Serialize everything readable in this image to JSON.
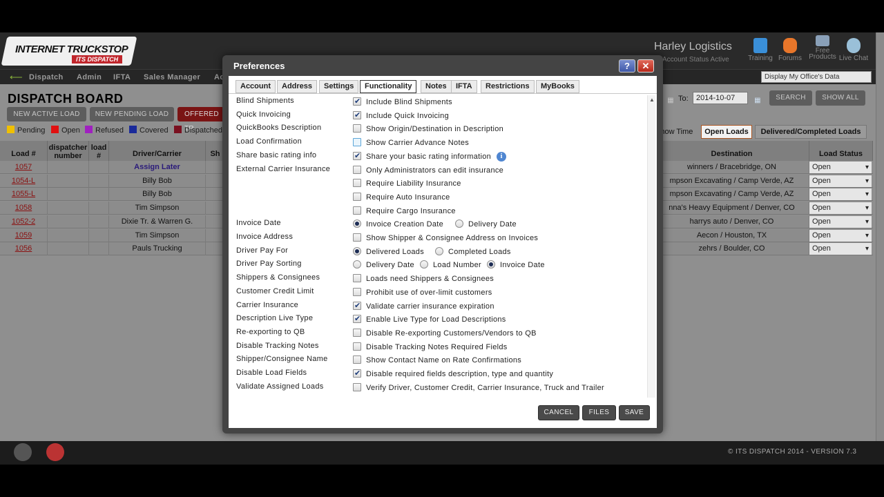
{
  "header": {
    "logo_line1": "INTERNET TRUCKSTOP",
    "logo_line2": "ITS DISPATCH",
    "company": "Harley Logistics",
    "account_status": "Account Status Active",
    "icons": [
      {
        "label": "Training",
        "icon": "book-icon"
      },
      {
        "label": "Forums",
        "icon": "speech-bubbles-icon"
      },
      {
        "label": "Free Products",
        "icon": "handshake-icon"
      },
      {
        "label": "Live Chat",
        "icon": "people-icon"
      }
    ]
  },
  "nav": {
    "items": [
      "Dispatch",
      "Admin",
      "IFTA",
      "Sales Manager",
      "Ac"
    ],
    "office_select": "Display My Office's Data"
  },
  "board": {
    "title": "DISPATCH BOARD",
    "buttons": [
      "NEW ACTIVE LOAD",
      "NEW PENDING LOAD",
      "OFFERED TR"
    ],
    "legend": [
      {
        "label": "Pending",
        "color": "#f0c000"
      },
      {
        "label": "Open",
        "color": "#e01010"
      },
      {
        "label": "Refused",
        "color": "#a020c0"
      },
      {
        "label": "Covered",
        "color": "#1a2a9a"
      },
      {
        "label": "Dispatched",
        "color": "#7a1020"
      }
    ],
    "date_to_label": "To:",
    "date_to_value": "2014-10-07",
    "search_label": "SEARCH",
    "show_all_label": "SHOW ALL",
    "tabs_right": [
      "Show Time",
      "Open Loads",
      "Delivered/Completed Loads"
    ],
    "columns_left": [
      "Load #",
      "dispatcher number",
      "load #",
      "Driver/Carrier",
      "Sh"
    ],
    "columns_right": [
      "Destination",
      "Load Status"
    ],
    "rows": [
      {
        "load": "1057",
        "driver": "Assign Later",
        "destination": "winners / Bracebridge, ON",
        "status": "Open"
      },
      {
        "load": "1054-L",
        "driver": "Billy Bob",
        "destination": "mpson Excavating / Camp Verde, AZ",
        "status": "Open"
      },
      {
        "load": "1055-L",
        "driver": "Billy Bob",
        "destination": "mpson Excavating / Camp Verde, AZ",
        "status": "Open"
      },
      {
        "load": "1058",
        "driver": "Tim Simpson",
        "destination": "nna's Heavy Equipment / Denver, CO",
        "status": "Open"
      },
      {
        "load": "1052-2",
        "driver": "Dixie Tr. & Warren G.",
        "destination": "harrys auto / Denver, CO",
        "status": "Open"
      },
      {
        "load": "1059",
        "driver": "Tim Simpson",
        "destination": "Aecon / Houston, TX",
        "status": "Open"
      },
      {
        "load": "1056",
        "driver": "Pauls Trucking",
        "destination": "zehrs / Boulder, CO",
        "status": "Open"
      }
    ]
  },
  "footer": {
    "text": "© ITS DISPATCH 2014  -  VERSION 7.3"
  },
  "modal": {
    "title": "Preferences",
    "tabs": [
      "Account",
      "Address",
      "Settings",
      "Functionality",
      "Notes",
      "IFTA",
      "Restrictions",
      "MyBooks"
    ],
    "active_tab": "Functionality",
    "prefs": [
      {
        "label": "Blind Shipments",
        "options": [
          {
            "type": "checkbox",
            "text": "Include Blind Shipments",
            "checked": true
          }
        ]
      },
      {
        "label": "Quick Invoicing",
        "options": [
          {
            "type": "checkbox",
            "text": "Include Quick Invoicing",
            "checked": true
          }
        ]
      },
      {
        "label": "QuickBooks Description",
        "options": [
          {
            "type": "checkbox",
            "text": "Show Origin/Destination in Description",
            "checked": false
          }
        ]
      },
      {
        "label": "Load Confirmation",
        "options": [
          {
            "type": "checkbox",
            "text": "Show Carrier Advance Notes",
            "checked": false
          }
        ]
      },
      {
        "label": "Share basic rating info",
        "options": [
          {
            "type": "checkbox",
            "text": "Share your basic rating information",
            "checked": true
          }
        ]
      },
      {
        "label": "External Carrier Insurance",
        "options": [
          {
            "type": "checkbox",
            "text": "Only Administrators can edit insurance",
            "checked": false
          }
        ]
      },
      {
        "label": "",
        "options": [
          {
            "type": "checkbox",
            "text": "Require Liability Insurance",
            "checked": false
          }
        ]
      },
      {
        "label": "",
        "options": [
          {
            "type": "checkbox",
            "text": "Require Auto Insurance",
            "checked": false
          }
        ]
      },
      {
        "label": "",
        "options": [
          {
            "type": "checkbox",
            "text": "Require Cargo Insurance",
            "checked": false
          }
        ]
      },
      {
        "label": "Invoice Date",
        "options": [
          {
            "type": "radio",
            "text": "Invoice Creation Date",
            "checked": true
          },
          {
            "type": "radio",
            "text": "Delivery Date",
            "checked": false
          }
        ]
      },
      {
        "label": "Invoice Address",
        "options": [
          {
            "type": "checkbox",
            "text": "Show Shipper & Consignee Address on Invoices",
            "checked": false
          }
        ]
      },
      {
        "label": "Driver Pay For",
        "options": [
          {
            "type": "radio",
            "text": "Delivered Loads",
            "checked": true
          },
          {
            "type": "radio",
            "text": "Completed Loads",
            "checked": false
          }
        ]
      },
      {
        "label": "Driver Pay Sorting",
        "options": [
          {
            "type": "radio",
            "text": "Delivery Date",
            "checked": false
          },
          {
            "type": "radio",
            "text": "Load Number",
            "checked": false
          },
          {
            "type": "radio",
            "text": "Invoice Date",
            "checked": true
          }
        ]
      },
      {
        "label": "Shippers & Consignees",
        "options": [
          {
            "type": "checkbox",
            "text": "Loads need Shippers & Consignees",
            "checked": false
          }
        ]
      },
      {
        "label": "Customer Credit Limit",
        "options": [
          {
            "type": "checkbox",
            "text": "Prohibit use of over-limit customers",
            "checked": false
          }
        ]
      },
      {
        "label": "Carrier Insurance",
        "options": [
          {
            "type": "checkbox",
            "text": "Validate carrier insurance expiration",
            "checked": true
          }
        ]
      },
      {
        "label": "Description Live Type",
        "options": [
          {
            "type": "checkbox",
            "text": "Enable Live Type for Load Descriptions",
            "checked": true
          }
        ]
      },
      {
        "label": "Re-exporting to QB",
        "options": [
          {
            "type": "checkbox",
            "text": "Disable Re-exporting Customers/Vendors to QB",
            "checked": false
          }
        ]
      },
      {
        "label": "Disable Tracking Notes",
        "options": [
          {
            "type": "checkbox",
            "text": "Disable Tracking Notes Required Fields",
            "checked": false
          }
        ]
      },
      {
        "label": "Shipper/Consignee Name",
        "options": [
          {
            "type": "checkbox",
            "text": "Show Contact Name on Rate Confirmations",
            "checked": false
          }
        ]
      },
      {
        "label": "Disable Load Fields",
        "options": [
          {
            "type": "checkbox",
            "text": "Disable required fields description, type and quantity",
            "checked": true
          }
        ]
      },
      {
        "label": "Validate Assigned Loads",
        "options": [
          {
            "type": "checkbox",
            "text": "Verify Driver, Customer Credit, Carrier Insurance, Truck and Trailer",
            "checked": false
          }
        ]
      }
    ],
    "buttons": {
      "cancel": "CANCEL",
      "files": "FILES",
      "save": "SAVE"
    }
  }
}
